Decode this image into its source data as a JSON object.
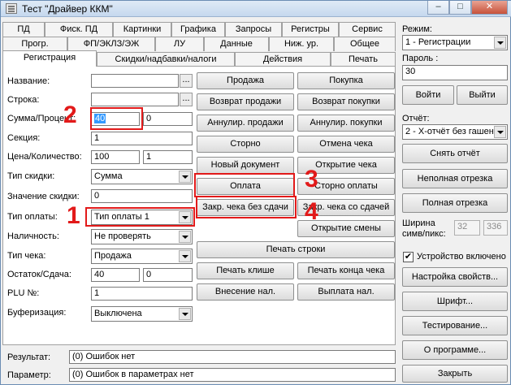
{
  "window": {
    "title": "Тест \"Драйвер ККМ\"",
    "controls": {
      "minimize": "–",
      "maximize": "□",
      "close": "✕"
    }
  },
  "tabs": {
    "row1": [
      "ПД",
      "Фиск. ПД",
      "Картинки",
      "Графика",
      "Запросы",
      "Регистры",
      "Сервис"
    ],
    "row2": [
      "Прогр.",
      "ФП/ЭКЛЗ/ЭЖ",
      "ЛУ",
      "Данные",
      "Ниж. ур.",
      "Общее"
    ],
    "row3": [
      "Регистрация",
      "Скидки/надбавки/налоги",
      "Действия",
      "Печать"
    ],
    "active": "Регистрация"
  },
  "form": {
    "name_label": "Название:",
    "name_value": "",
    "line_label": "Строка:",
    "line_value": "",
    "dots": "...",
    "sum_label": "Сумма/Процент:",
    "sum_value": "40",
    "percent_value": "0",
    "section_label": "Секция:",
    "section_value": "1",
    "price_label": "Цена/Количество:",
    "price_value": "100",
    "qty_value": "1",
    "discount_type_label": "Тип скидки:",
    "discount_type_value": "Сумма",
    "discount_value_label": "Значение скидки:",
    "discount_value": "0",
    "payment_type_label": "Тип оплаты:",
    "payment_type_value": "Тип оплаты 1",
    "cash_label": "Наличность:",
    "cash_value": "Не проверять",
    "check_type_label": "Тип чека:",
    "check_type_value": "Продажа",
    "remainder_label": "Остаток/Сдача:",
    "remainder_value": "40",
    "change_value": "0",
    "plu_label": "PLU №:",
    "plu_value": "1",
    "buffer_label": "Буферизация:",
    "buffer_value": "Выключена"
  },
  "buttons": {
    "sale": "Продажа",
    "purchase": "Покупка",
    "return_sale": "Возврат продажи",
    "return_purchase": "Возврат покупки",
    "annul_sale": "Аннулир. продажи",
    "annul_purchase": "Аннулир. покупки",
    "storno": "Сторно",
    "cancel_check": "Отмена чека",
    "new_document": "Новый документ",
    "open_check": "Открытие чека",
    "payment": "Оплата",
    "storno_payment": "Сторно оплаты",
    "close_no_change": "Закр. чека без сдачи",
    "close_with_change": "Закр. чека со сдачей",
    "open_shift": "Открытие смены",
    "print_line": "Печать строки",
    "print_cliche": "Печать клише",
    "print_check_end": "Печать конца чека",
    "cash_in": "Внесение нал.",
    "cash_out": "Выплата нал."
  },
  "annotations": {
    "n1": "1",
    "n2": "2",
    "n3": "3",
    "n4": "4"
  },
  "status": {
    "result_label": "Результат:",
    "result_value": "(0) Ошибок нет",
    "param_label": "Параметр:",
    "param_value": "(0) Ошибок в параметрах нет"
  },
  "sidebar": {
    "mode_label": "Режим:",
    "mode_value": "1 - Регистрации",
    "password_label": "Пароль :",
    "password_value": "30",
    "login": "Войти",
    "logout": "Выйти",
    "report_label": "Отчёт:",
    "report_value": "2 - X-отчёт без гашен",
    "take_report": "Снять отчёт",
    "partial_cut": "Неполная отрезка",
    "full_cut": "Полная отрезка",
    "width_label_1": "Ширина",
    "width_label_2": "симв/пикс:",
    "width_chars": "32",
    "width_pixels": "336",
    "device_enabled": "Устройство включено",
    "device_enabled_checked": true,
    "check_mark": "✔",
    "device_props": "Настройка свойств...",
    "font": "Шрифт...",
    "testing": "Тестирование...",
    "about": "О программе...",
    "close": "Закрыть"
  },
  "colors": {
    "annotation": "#e21a1a",
    "selection": "#3399ff"
  }
}
